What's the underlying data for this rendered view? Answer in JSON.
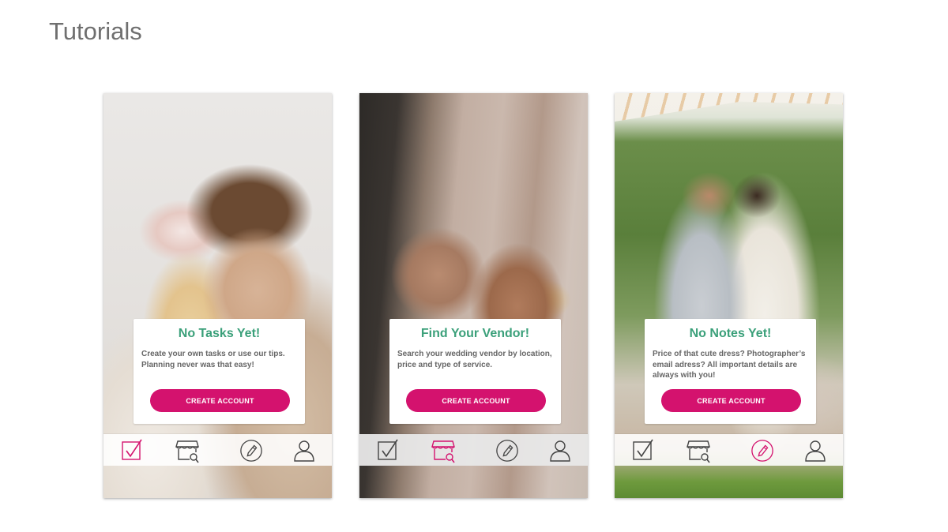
{
  "page": {
    "title": "Tutorials"
  },
  "colors": {
    "accent": "#d4126e",
    "title_green": "#3ba07a",
    "icon_gray": "#444444"
  },
  "screens": [
    {
      "card": {
        "title": "No Tasks Yet!",
        "description": "Create your own tasks or use our tips. Planning never was that easy!",
        "button_label": "CREATE ACCOUNT"
      },
      "tabs": [
        {
          "icon": "checkbox-icon",
          "active": true
        },
        {
          "icon": "store-search-icon",
          "active": false
        },
        {
          "icon": "pencil-icon",
          "active": false
        },
        {
          "icon": "user-icon",
          "active": false
        }
      ]
    },
    {
      "card": {
        "title": "Find Your Vendor!",
        "description": "Search your wedding vendor by location, price and type of service.",
        "button_label": "CREATE ACCOUNT"
      },
      "tabs": [
        {
          "icon": "checkbox-icon",
          "active": false
        },
        {
          "icon": "store-search-icon",
          "active": true
        },
        {
          "icon": "pencil-icon",
          "active": false
        },
        {
          "icon": "user-icon",
          "active": false
        }
      ]
    },
    {
      "card": {
        "title": "No Notes Yet!",
        "description": "Price of that cute dress? Photographer’s email adress? All important details are always with you!",
        "button_label": "CREATE ACCOUNT"
      },
      "tabs": [
        {
          "icon": "checkbox-icon",
          "active": false
        },
        {
          "icon": "store-search-icon",
          "active": false
        },
        {
          "icon": "pencil-icon",
          "active": true
        },
        {
          "icon": "user-icon",
          "active": false
        }
      ]
    }
  ]
}
